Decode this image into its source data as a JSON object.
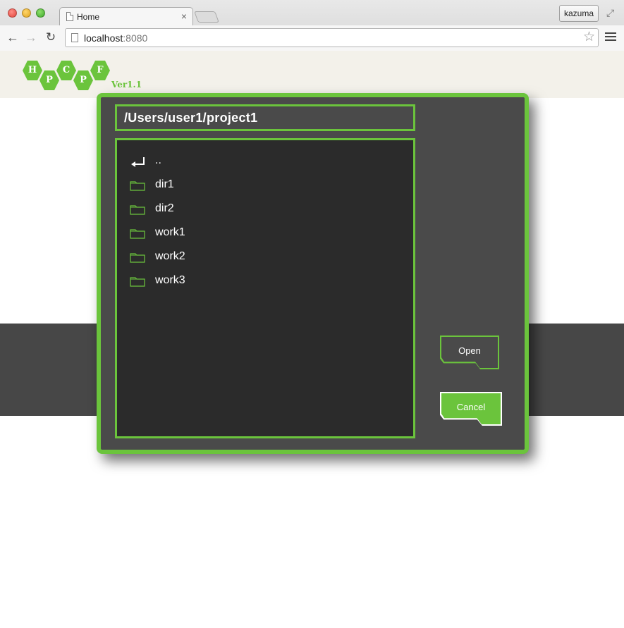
{
  "browser": {
    "tab_title": "Home",
    "tab_close": "×",
    "user_label": "kazuma",
    "url_host": "localhost",
    "url_port": ":8080"
  },
  "logo": {
    "letters": [
      "H",
      "P",
      "C",
      "P",
      "F"
    ],
    "version": "Ver1.1",
    "color": "#6bc43c"
  },
  "dialog": {
    "path": "/Users/user1/project1",
    "items": [
      {
        "label": "..",
        "icon": "up-arrow-icon"
      },
      {
        "label": "dir1",
        "icon": "folder-icon"
      },
      {
        "label": "dir2",
        "icon": "folder-icon"
      },
      {
        "label": "work1",
        "icon": "folder-icon"
      },
      {
        "label": "work2",
        "icon": "folder-icon"
      },
      {
        "label": "work3",
        "icon": "folder-icon"
      }
    ],
    "open_label": "Open",
    "cancel_label": "Cancel"
  },
  "colors": {
    "accent": "#6bc43c",
    "dialog_bg": "#4a4a4a",
    "list_bg": "#2b2b2b",
    "band": "#474747"
  }
}
